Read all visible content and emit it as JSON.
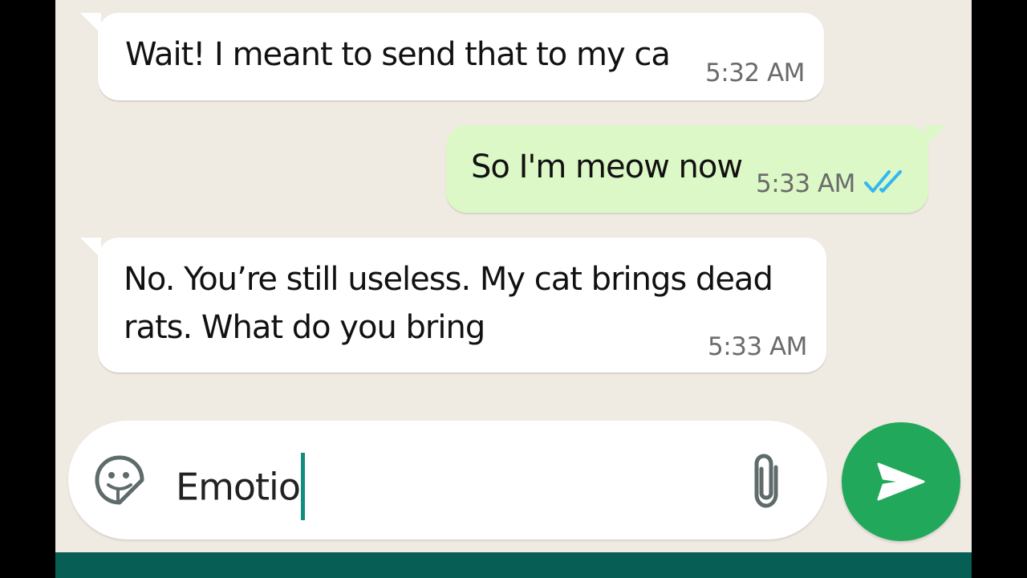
{
  "colors": {
    "chat_background": "#efeae2",
    "incoming_bubble": "#ffffff",
    "outgoing_bubble": "#dcf8c6",
    "send_button": "#21a85a",
    "bottom_bar": "#075e54",
    "read_ticks": "#34b7f1",
    "cursor": "#128c7e"
  },
  "messages": [
    {
      "direction": "incoming",
      "lines": [
        "Wait! I meant to send that to my ca"
      ],
      "time": "5:32 AM"
    },
    {
      "direction": "outgoing",
      "lines": [
        "So I'm meow now"
      ],
      "time": "5:33 AM",
      "status_icon": "double-check-read-icon"
    },
    {
      "direction": "incoming",
      "lines": [
        "No. You’re still useless. My cat brings dead",
        "rats. What do you bring"
      ],
      "time": "5:33 AM"
    }
  ],
  "composer": {
    "value": "Emotio",
    "left_icon": "sticker-icon",
    "attach_icon": "paperclip-icon",
    "send_icon": "send-icon"
  }
}
